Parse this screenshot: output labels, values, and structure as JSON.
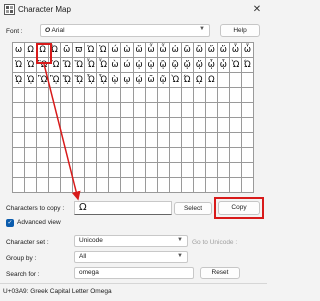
{
  "window": {
    "title": "Character Map"
  },
  "font_row": {
    "label": "Font :",
    "value": "Arial",
    "help_label": "Help"
  },
  "grid": {
    "rows": [
      [
        "ω",
        "Ω",
        "Ω",
        "Ώ",
        "ῶ",
        "ϖ",
        "Ὠ",
        "Ὡ",
        "ώ",
        "ὡ",
        "ὥ",
        "ὦ",
        "ὧ",
        "ὠ",
        "ὢ",
        "ὣ",
        "ὤ",
        "ὥ",
        "ὦ",
        "ὧ"
      ],
      [
        "Ὠ",
        "Ὡ",
        "Ὢ",
        "Ὣ",
        "Ὤ",
        "Ὥ",
        "Ὦ",
        "Ὧ",
        "ὼ",
        "ώ",
        "ᾠ",
        "ᾡ",
        "ᾢ",
        "ᾣ",
        "ᾤ",
        "ᾥ",
        "ᾦ",
        "ᾧ",
        "Ὼ",
        "Ώ"
      ],
      [
        "ᾨ",
        "ᾩ",
        "ᾪ",
        "ᾫ",
        "ᾬ",
        "ᾭ",
        "ᾮ",
        "ᾯ",
        "ῲ",
        "ῳ",
        "ῴ",
        "ῶ",
        "ῷ",
        "Ὼ",
        "Ώ",
        "ῼ",
        "Ω",
        "",
        "",
        ""
      ],
      [
        "",
        "",
        "",
        "",
        "",
        "",
        "",
        "",
        "",
        "",
        "",
        "",
        "",
        "",
        "",
        "",
        "",
        "",
        "",
        ""
      ],
      [
        "",
        "",
        "",
        "",
        "",
        "",
        "",
        "",
        "",
        "",
        "",
        "",
        "",
        "",
        "",
        "",
        "",
        "",
        "",
        ""
      ],
      [
        "",
        "",
        "",
        "",
        "",
        "",
        "",
        "",
        "",
        "",
        "",
        "",
        "",
        "",
        "",
        "",
        "",
        "",
        "",
        ""
      ],
      [
        "",
        "",
        "",
        "",
        "",
        "",
        "",
        "",
        "",
        "",
        "",
        "",
        "",
        "",
        "",
        "",
        "",
        "",
        "",
        ""
      ],
      [
        "",
        "",
        "",
        "",
        "",
        "",
        "",
        "",
        "",
        "",
        "",
        "",
        "",
        "",
        "",
        "",
        "",
        "",
        "",
        ""
      ],
      [
        "",
        "",
        "",
        "",
        "",
        "",
        "",
        "",
        "",
        "",
        "",
        "",
        "",
        "",
        "",
        "",
        "",
        "",
        "",
        ""
      ],
      [
        "",
        "",
        "",
        "",
        "",
        "",
        "",
        "",
        "",
        "",
        "",
        "",
        "",
        "",
        "",
        "",
        "",
        "",
        "",
        ""
      ]
    ]
  },
  "copy_row": {
    "label": "Characters to copy :",
    "value": "Ω",
    "select_label": "Select",
    "copy_label": "Copy"
  },
  "advanced": {
    "label": "Advanced view",
    "checked": true
  },
  "charset": {
    "label": "Character set :",
    "value": "Unicode",
    "goto_label": "Go to Unicode :"
  },
  "groupby": {
    "label": "Group by :",
    "value": "All"
  },
  "search": {
    "label": "Search for :",
    "value": "omega",
    "reset_label": "Reset"
  },
  "status": {
    "text": "U+03A9: Greek Capital Letter Omega"
  },
  "colors": {
    "annotation": "#d81a1a",
    "accent": "#0b5cad"
  }
}
